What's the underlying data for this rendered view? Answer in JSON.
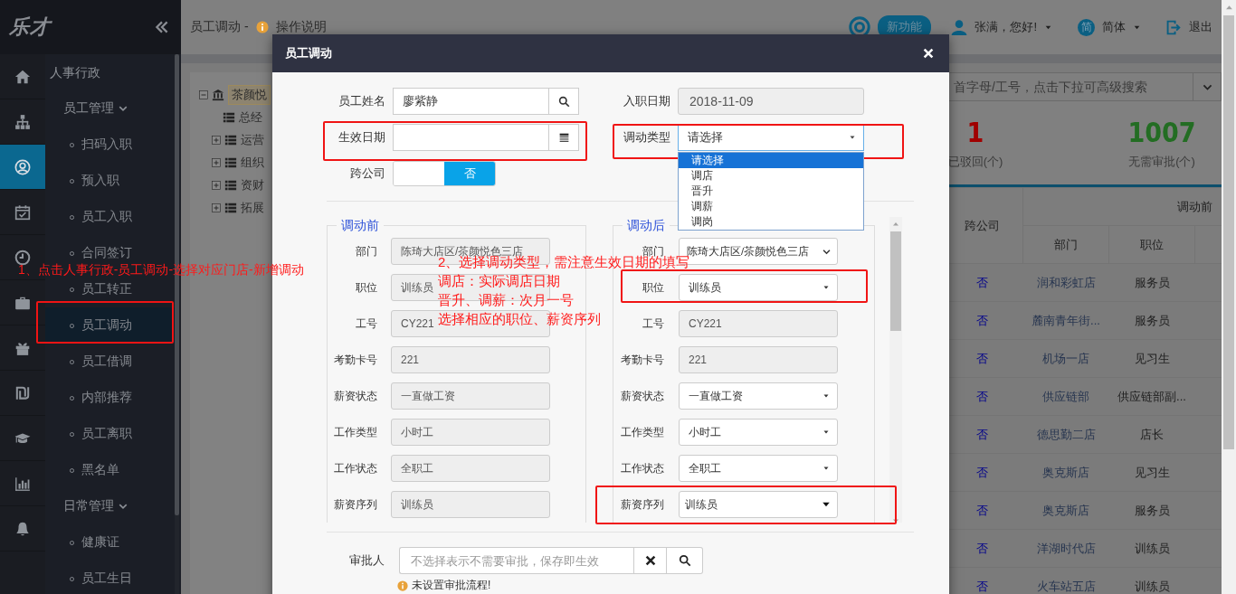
{
  "logo": "乐才",
  "rail": [
    {
      "selected": false
    },
    {
      "selected": false
    },
    {
      "selected": true
    },
    {
      "selected": false
    },
    {
      "selected": false
    },
    {
      "selected": false
    },
    {
      "selected": false
    },
    {
      "selected": false
    },
    {
      "selected": false
    },
    {
      "selected": false
    },
    {
      "selected": false
    }
  ],
  "sidebar": {
    "section": "人事行政",
    "groups": [
      {
        "label": "员工管理",
        "expanded": true,
        "items": [
          {
            "label": "扫码入职",
            "selected": false
          },
          {
            "label": "预入职",
            "selected": false
          },
          {
            "label": "员工入职",
            "selected": false
          },
          {
            "label": "合同签订",
            "selected": false
          },
          {
            "label": "员工转正",
            "selected": false
          },
          {
            "label": "员工调动",
            "selected": true
          },
          {
            "label": "员工借调",
            "selected": false
          },
          {
            "label": "内部推荐",
            "selected": false
          },
          {
            "label": "员工离职",
            "selected": false
          },
          {
            "label": "黑名单",
            "selected": false
          }
        ]
      },
      {
        "label": "日常管理",
        "expanded": true,
        "items": [
          {
            "label": "健康证",
            "selected": false
          },
          {
            "label": "员工生日",
            "selected": false
          }
        ]
      }
    ]
  },
  "header": {
    "title": "员工调动 -",
    "help": "操作说明",
    "badge": "新功能",
    "user": "张满，您好!",
    "language_icon": "简",
    "language": "简体",
    "logout": "退出"
  },
  "tree": {
    "label": "茶颜悦",
    "expanded": true,
    "children": [
      {
        "label": "总经",
        "kind": "leaf"
      },
      {
        "label": "运营",
        "kind": "branch",
        "expanded": false
      },
      {
        "label": "组织",
        "kind": "branch",
        "expanded": false
      },
      {
        "label": "资财",
        "kind": "branch",
        "expanded": false
      },
      {
        "label": "拓展",
        "kind": "branch",
        "expanded": false
      }
    ]
  },
  "search": {
    "placeholder": "首字母/工号，点击下拉可高级搜索"
  },
  "stats": [
    {
      "value": "1",
      "label": "已驳回(个)",
      "color": "#a00000"
    },
    {
      "value": "1007",
      "label": "无需审批(个)",
      "color": "#236d23"
    }
  ],
  "table": {
    "cross_company": "跨公司",
    "group": "调动前",
    "columns": [
      "部门",
      "职位"
    ],
    "rows": [
      {
        "cross_company": "否",
        "department": "润和彩虹店",
        "position": "服务员"
      },
      {
        "cross_company": "否",
        "department": "麓南青年街...",
        "position": "服务员"
      },
      {
        "cross_company": "否",
        "department": "机场一店",
        "position": "见习生"
      },
      {
        "cross_company": "否",
        "department": "供应链部",
        "position": "供应链部副..."
      },
      {
        "cross_company": "否",
        "department": "德思勤二店",
        "position": "店长"
      },
      {
        "cross_company": "否",
        "department": "奥克斯店",
        "position": "见习生"
      },
      {
        "cross_company": "否",
        "department": "奥克斯店",
        "position": "服务员"
      },
      {
        "cross_company": "否",
        "department": "洋湖时代店",
        "position": "训练员"
      },
      {
        "cross_company": "否",
        "department": "火车站五店",
        "position": "训练员"
      }
    ]
  },
  "modal": {
    "title": "员工调动",
    "fields": [
      {
        "label": "员工姓名",
        "kind": "search",
        "value": "廖紫静"
      },
      {
        "label": "入职日期",
        "kind": "readonly",
        "value": "2018-11-09"
      },
      {
        "label": "生效日期",
        "kind": "date"
      },
      {
        "label": "调动类型",
        "kind": "select",
        "value": "请选择",
        "expanded": true,
        "options": [
          {
            "label": "请选择",
            "selected": true
          },
          {
            "label": "调店",
            "selected": false
          },
          {
            "label": "晋升",
            "selected": false
          },
          {
            "label": "调薪",
            "selected": false
          },
          {
            "label": "调岗",
            "selected": false
          }
        ]
      },
      {
        "label": "跨公司",
        "kind": "toggle",
        "on": false,
        "value": "否"
      }
    ],
    "before": {
      "legend": "调动前",
      "fields": [
        {
          "label": "部门",
          "kind": "readonly",
          "value": "陈琦大店区/茶颜悦色三店"
        },
        {
          "label": "职位",
          "kind": "readonly",
          "value": "训练员"
        },
        {
          "label": "工号",
          "kind": "readonly",
          "value": "CY221"
        },
        {
          "label": "考勤卡号",
          "kind": "readonly",
          "value": "221"
        },
        {
          "label": "薪资状态",
          "kind": "readonly",
          "value": "一直做工资"
        },
        {
          "label": "工作类型",
          "kind": "readonly",
          "value": "小时工"
        },
        {
          "label": "工作状态",
          "kind": "readonly",
          "value": "全职工"
        },
        {
          "label": "薪资序列",
          "kind": "readonly",
          "value": "训练员"
        }
      ]
    },
    "after": {
      "legend": "调动后",
      "fields": [
        {
          "label": "部门",
          "kind": "chevron",
          "value": "陈琦大店区/茶颜悦色三店"
        },
        {
          "label": "职位",
          "kind": "select",
          "value": "训练员"
        },
        {
          "label": "工号",
          "kind": "readonly",
          "value": "CY221"
        },
        {
          "label": "考勤卡号",
          "kind": "readonly",
          "value": "221"
        },
        {
          "label": "薪资状态",
          "kind": "select",
          "value": "一直做工资"
        },
        {
          "label": "工作类型",
          "kind": "select",
          "value": "小时工"
        },
        {
          "label": "工作状态",
          "kind": "select",
          "value": "全职工"
        },
        {
          "label": "薪资序列",
          "kind": "combo",
          "value": "训练员"
        }
      ]
    },
    "approver": {
      "label": "审批人",
      "placeholder": "不选择表示不需要审批，保存即生效",
      "note": "未设置审批流程!"
    }
  },
  "annotations": {
    "step_1": "1、点击人事行政-员工调动-选择对应门店-新增调动",
    "step_2": [
      "2、选择调动类型，需注意生效日期的填写",
      "调店：实际调店日期",
      "晋升、调薪：次月一号",
      "选择相应的职位、薪资序列"
    ]
  }
}
